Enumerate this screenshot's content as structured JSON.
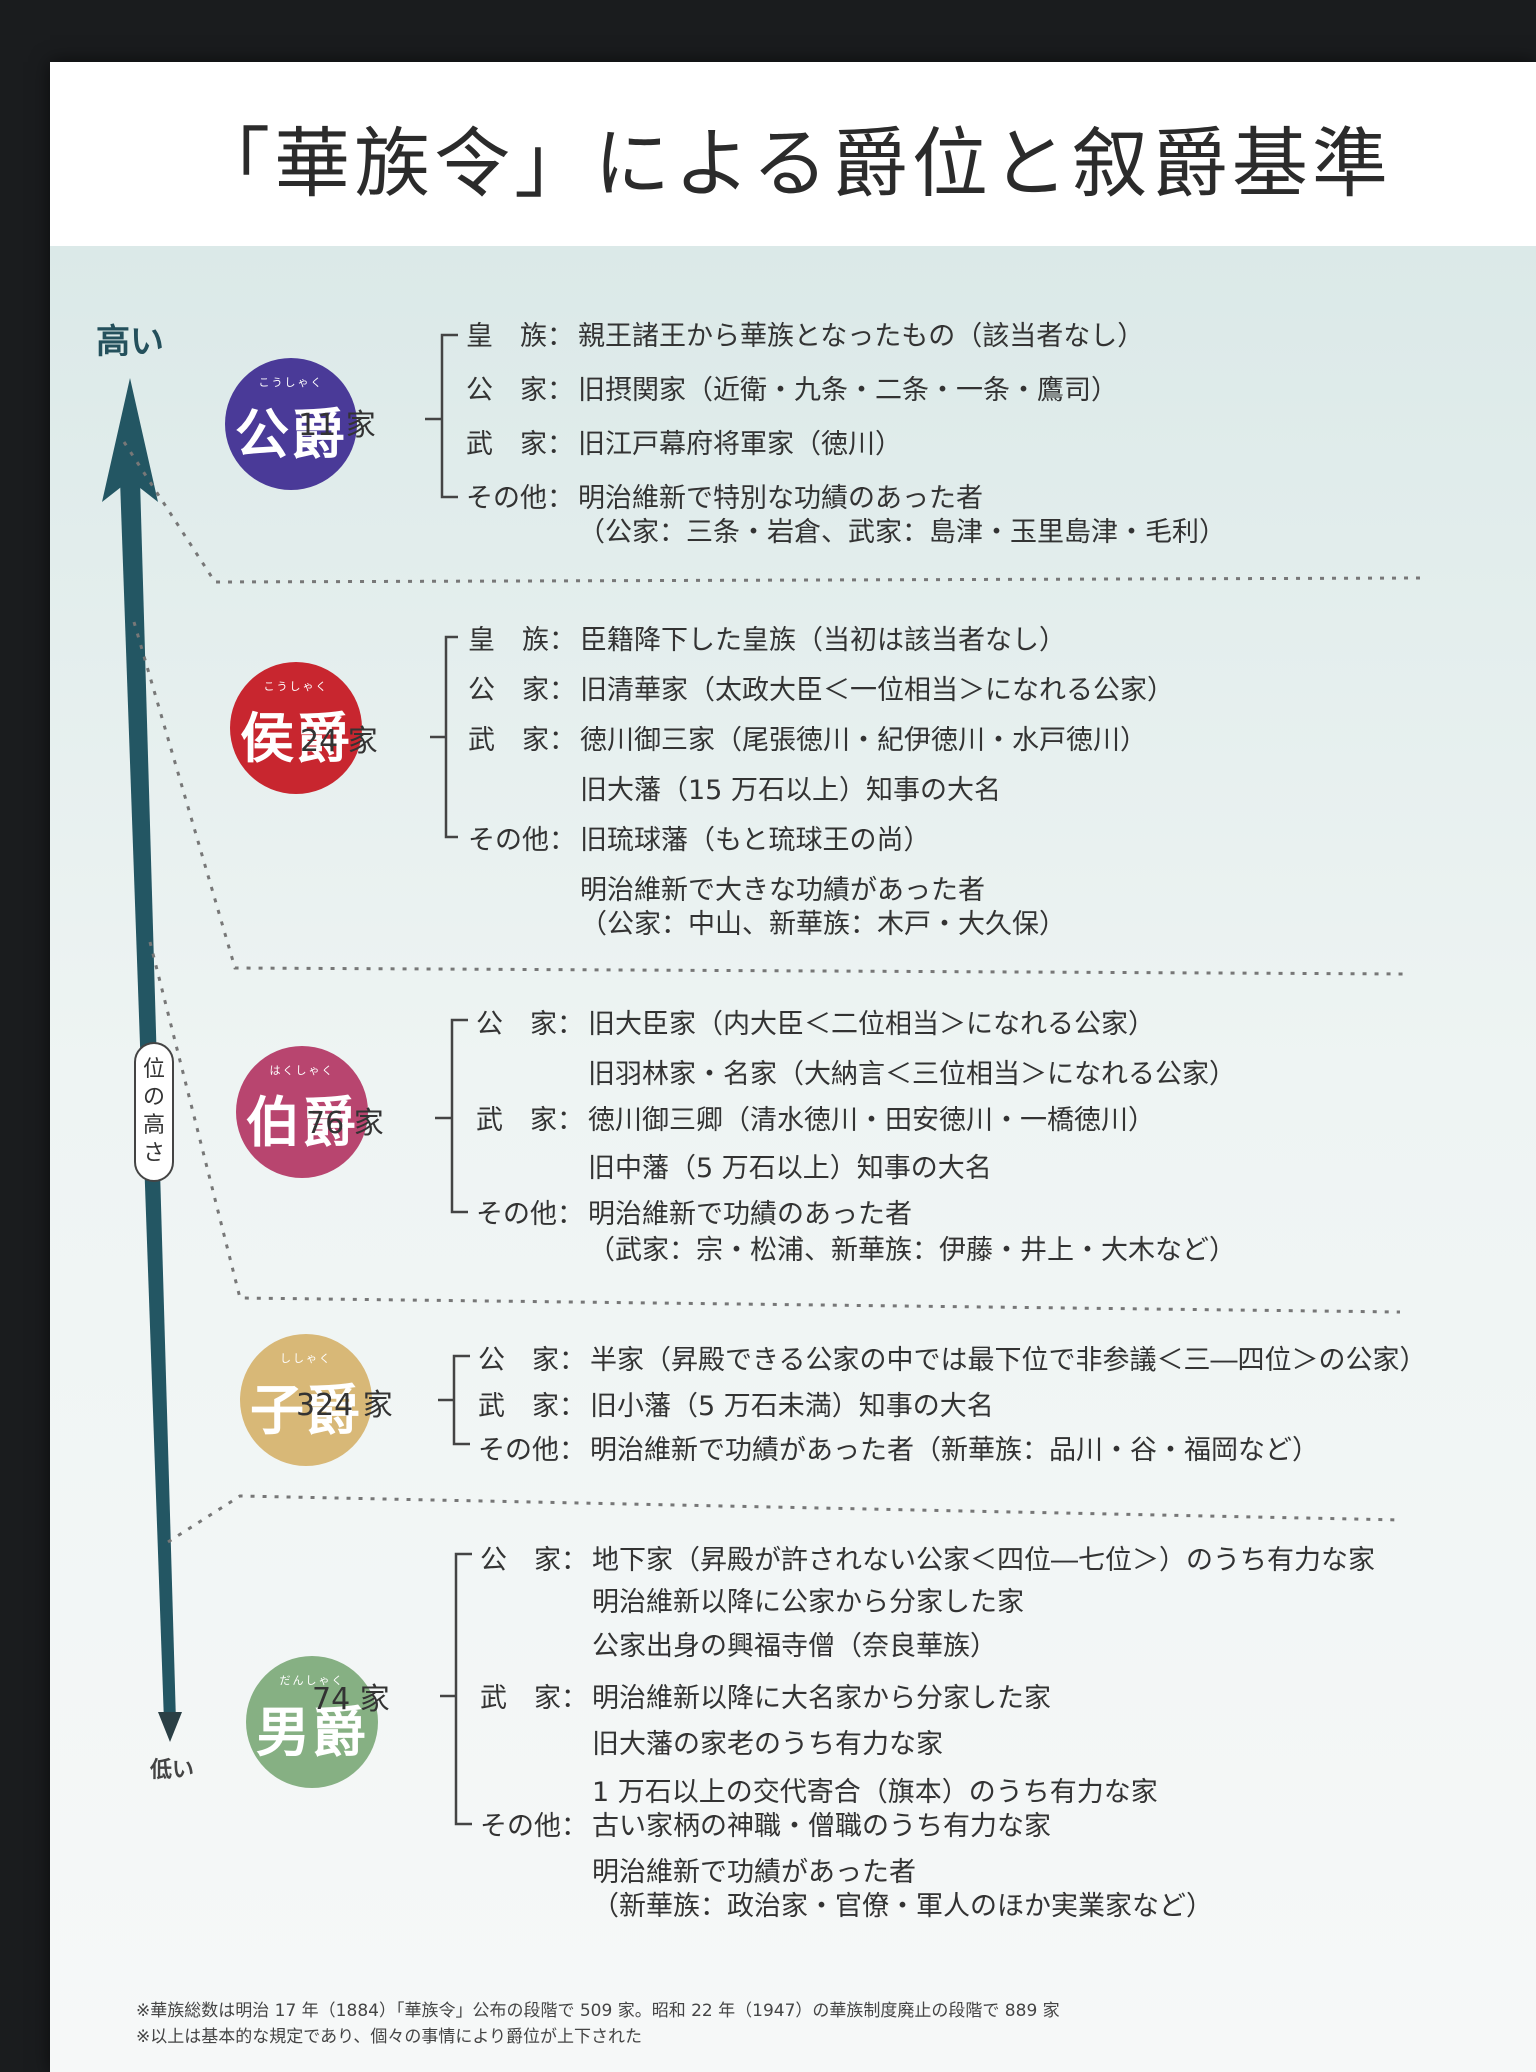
{
  "title": "「華族令」による爵位と叙爵基準",
  "axis": {
    "high": "高い",
    "low": "低い",
    "height_label": "位の高さ"
  },
  "colors": {
    "koshaku": "#4a3a98",
    "koshaku_ko": "#c8262f",
    "hakushaku": "#b8456f",
    "shishaku": "#d8b877",
    "danshaku": "#86b083",
    "arrow": "#235663"
  },
  "ranks": [
    {
      "ruby": "こうしゃく",
      "name": "公爵",
      "count": "11 家",
      "rows": [
        {
          "label": "皇　族：",
          "text": "親王諸王から華族となったもの（該当者なし）"
        },
        {
          "label": "公　家：",
          "text": "旧摂関家（近衛・九条・二条・一条・鷹司）"
        },
        {
          "label": "武　家：",
          "text": "旧江戸幕府将軍家（徳川）"
        },
        {
          "label": "その他：",
          "text": "明治維新で特別な功績のあった者"
        },
        {
          "label": "",
          "text": "（公家：三条・岩倉、武家：島津・玉里島津・毛利）"
        }
      ]
    },
    {
      "ruby": "こうしゃく",
      "name": "侯爵",
      "count": "24 家",
      "rows": [
        {
          "label": "皇　族：",
          "text": "臣籍降下した皇族（当初は該当者なし）"
        },
        {
          "label": "公　家：",
          "text": "旧清華家（太政大臣＜一位相当＞になれる公家）"
        },
        {
          "label": "武　家：",
          "text": "徳川御三家（尾張徳川・紀伊徳川・水戸徳川）"
        },
        {
          "label": "",
          "text": "旧大藩（15 万石以上）知事の大名"
        },
        {
          "label": "その他：",
          "text": "旧琉球藩（もと琉球王の尚）"
        },
        {
          "label": "",
          "text": "明治維新で大きな功績があった者"
        },
        {
          "label": "",
          "text": "（公家：中山、新華族：木戸・大久保）"
        }
      ]
    },
    {
      "ruby": "はくしゃく",
      "name": "伯爵",
      "count": "76 家",
      "rows": [
        {
          "label": "公　家：",
          "text": "旧大臣家（内大臣＜二位相当＞になれる公家）"
        },
        {
          "label": "",
          "text": "旧羽林家・名家（大納言＜三位相当＞になれる公家）"
        },
        {
          "label": "武　家：",
          "text": "徳川御三卿（清水徳川・田安徳川・一橋徳川）"
        },
        {
          "label": "",
          "text": "旧中藩（5 万石以上）知事の大名"
        },
        {
          "label": "その他：",
          "text": "明治維新で功績のあった者"
        },
        {
          "label": "",
          "text": "（武家：宗・松浦、新華族：伊藤・井上・大木など）"
        }
      ]
    },
    {
      "ruby": "ししゃく",
      "name": "子爵",
      "count": "324 家",
      "rows": [
        {
          "label": "公　家：",
          "text": "半家（昇殿できる公家の中では最下位で非参議＜三―四位＞の公家）"
        },
        {
          "label": "武　家：",
          "text": "旧小藩（5 万石未満）知事の大名"
        },
        {
          "label": "その他：",
          "text": "明治維新で功績があった者（新華族：品川・谷・福岡など）"
        }
      ]
    },
    {
      "ruby": "だんしゃく",
      "name": "男爵",
      "count": "74 家",
      "rows": [
        {
          "label": "公　家：",
          "text": "地下家（昇殿が許されない公家＜四位―七位＞）のうち有力な家"
        },
        {
          "label": "",
          "text": "明治維新以降に公家から分家した家"
        },
        {
          "label": "",
          "text": "公家出身の興福寺僧（奈良華族）"
        },
        {
          "label": "武　家：",
          "text": "明治維新以降に大名家から分家した家"
        },
        {
          "label": "",
          "text": "旧大藩の家老のうち有力な家"
        },
        {
          "label": "",
          "text": "1 万石以上の交代寄合（旗本）のうち有力な家"
        },
        {
          "label": "その他：",
          "text": "古い家柄の神職・僧職のうち有力な家"
        },
        {
          "label": "",
          "text": "明治維新で功績があった者"
        },
        {
          "label": "",
          "text": "（新華族：政治家・官僚・軍人のほか実業家など）"
        }
      ]
    }
  ],
  "footnotes": [
    "※華族総数は明治 17 年（1884）「華族令」公布の段階で 509 家。昭和 22 年（1947）の華族制度廃止の段階で 889 家",
    "※以上は基本的な規定であり、個々の事情により爵位が上下された"
  ]
}
